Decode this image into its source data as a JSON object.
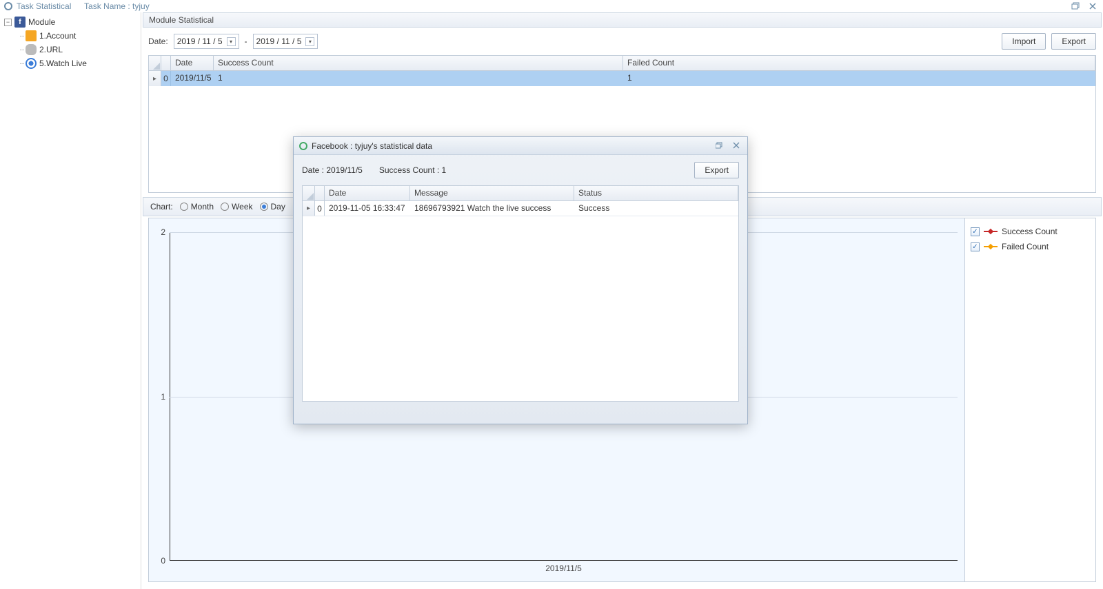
{
  "titlebar": {
    "app": "Task Statistical",
    "task_label": "Task Name : tyjuy"
  },
  "sidebar": {
    "root": "Module",
    "items": [
      {
        "label": "1.Account"
      },
      {
        "label": "2.URL"
      },
      {
        "label": "5.Watch Live"
      }
    ]
  },
  "main": {
    "header": "Module Statistical",
    "date_label": "Date:",
    "date_from": "2019 / 11 / 5",
    "date_sep": "-",
    "date_to": "2019 / 11 / 5",
    "import_btn": "Import",
    "export_btn": "Export",
    "grid": {
      "cols": {
        "date": "Date",
        "success": "Success Count",
        "failed": "Failed Count"
      },
      "rows": [
        {
          "idx": "0",
          "date": "2019/11/5",
          "success": "1",
          "failed": "1"
        }
      ]
    },
    "chart_label": "Chart:",
    "radios": {
      "month": "Month",
      "week": "Week",
      "day": "Day"
    },
    "legend": {
      "success": "Success Count",
      "failed": "Failed Count"
    }
  },
  "dialog": {
    "title": "Facebook : tyjuy's statistical data",
    "date_line": "Date : 2019/11/5",
    "success_line": "Success Count : 1",
    "export_btn": "Export",
    "grid": {
      "cols": {
        "date": "Date",
        "message": "Message",
        "status": "Status"
      },
      "rows": [
        {
          "idx": "0",
          "date": "2019-11-05 16:33:47",
          "message": "18696793921 Watch the live success",
          "status": "Success"
        }
      ]
    }
  },
  "chart_data": {
    "type": "line",
    "categories": [
      "2019/11/5"
    ],
    "series": [
      {
        "name": "Success Count",
        "values": [
          1
        ]
      },
      {
        "name": "Failed Count",
        "values": [
          1
        ]
      }
    ],
    "ylim": [
      0,
      2
    ],
    "yticks": [
      0,
      1,
      2
    ],
    "xlabel": "",
    "ylabel": ""
  }
}
